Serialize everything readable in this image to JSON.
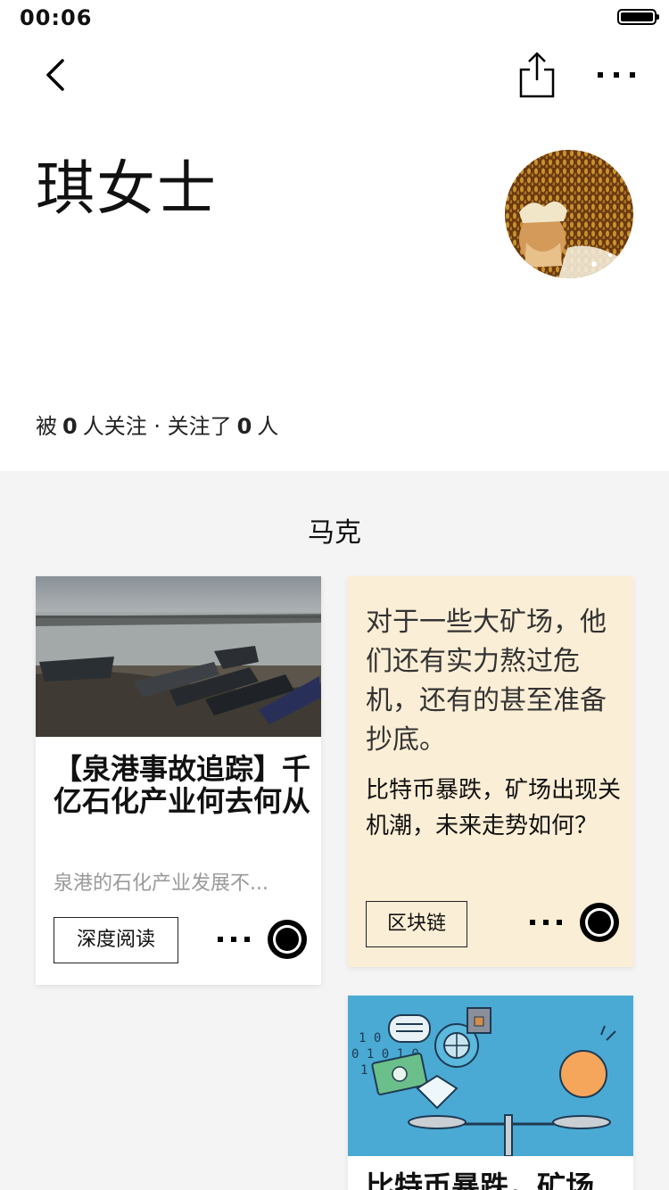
{
  "status_bar": {
    "time": "00:06"
  },
  "profile": {
    "name": "琪女士",
    "follow_prefix": "被",
    "followers": "0",
    "follow_mid": "人关注 · 关注了",
    "following": "0",
    "follow_suffix": "人"
  },
  "section": {
    "title": "马克"
  },
  "cards": [
    {
      "title": "【泉港事故追踪】千亿石化产业何去何从",
      "summary": "泉港的石化产业发展不...",
      "tag": "深度阅读"
    },
    {
      "quote": "对于一些大矿场，他们还有实力熬过危机，还有的甚至准备抄底。",
      "subtitle": "比特币暴跌，矿场出现关机潮，未来走势如何？",
      "tag": "区块链"
    },
    {
      "title": "比特币暴跌，矿场"
    }
  ],
  "colors": {
    "highlight": "#f9e49a",
    "quote_card_bg": "#fbeed6",
    "gray_bg": "#f4f4f4",
    "illustration_bg": "#4aaad4"
  }
}
